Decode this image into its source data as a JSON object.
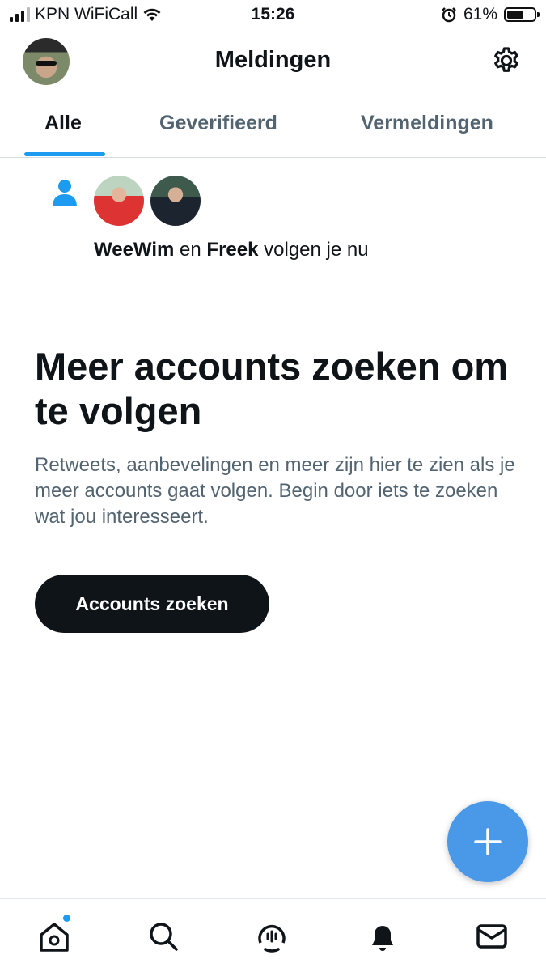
{
  "status_bar": {
    "carrier": "KPN WiFiCall",
    "time": "15:26",
    "battery_percent": "61%",
    "battery_level": 0.61,
    "icons": [
      "signal-icon",
      "wifi-icon",
      "alarm-icon",
      "battery-icon"
    ]
  },
  "header": {
    "title": "Meldingen",
    "icons": [
      "profile-avatar",
      "gear-icon"
    ]
  },
  "tabs": [
    {
      "label": "Alle",
      "active": true
    },
    {
      "label": "Geverifieerd",
      "active": false
    },
    {
      "label": "Vermeldingen",
      "active": false
    }
  ],
  "notification": {
    "icon": "person-icon",
    "user1": "WeeWim",
    "conjunction": "en",
    "user2": "Freek",
    "action": "volgen je nu"
  },
  "empty_state": {
    "title": "Meer accounts zoeken om te volgen",
    "description": "Retweets, aanbevelingen en meer zijn hier te zien als je meer accounts gaat volgen. Begin door iets te zoeken wat jou interesseert.",
    "button_label": "Accounts zoeken"
  },
  "fab": {
    "icon": "plus-icon"
  },
  "bottom_nav": {
    "items": [
      "home-icon",
      "search-icon",
      "spaces-icon",
      "bell-icon",
      "mail-icon"
    ],
    "active": "bell-icon",
    "badge_on": "home-icon"
  },
  "colors": {
    "accent": "#1d9bf0",
    "fab": "#4a99e9",
    "text_primary": "#0f1419",
    "text_secondary": "#536471",
    "button_dark": "#0f1419"
  }
}
